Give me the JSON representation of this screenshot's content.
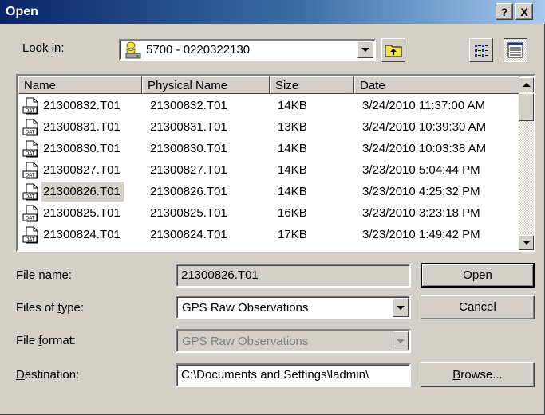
{
  "window": {
    "title": "Open",
    "help": "?",
    "close": "X"
  },
  "lookin": {
    "label_pre": "Look ",
    "label_key": "i",
    "label_post": "n:",
    "value": "5700 - 0220322130"
  },
  "columns": {
    "name": "Name",
    "physical": "Physical Name",
    "size": "Size",
    "date": "Date"
  },
  "files": [
    {
      "name": "21300832.T01",
      "physical": "21300832.T01",
      "size": "14KB",
      "date": "3/24/2010 11:37:00 AM"
    },
    {
      "name": "21300831.T01",
      "physical": "21300831.T01",
      "size": "13KB",
      "date": "3/24/2010 10:39:30 AM"
    },
    {
      "name": "21300830.T01",
      "physical": "21300830.T01",
      "size": "14KB",
      "date": "3/24/2010 10:03:38 AM"
    },
    {
      "name": "21300827.T01",
      "physical": "21300827.T01",
      "size": "14KB",
      "date": "3/23/2010 5:04:44 PM"
    },
    {
      "name": "21300826.T01",
      "physical": "21300826.T01",
      "size": "14KB",
      "date": "3/23/2010 4:25:32 PM"
    },
    {
      "name": "21300825.T01",
      "physical": "21300825.T01",
      "size": "16KB",
      "date": "3/23/2010 3:23:18 PM"
    },
    {
      "name": "21300824.T01",
      "physical": "21300824.T01",
      "size": "17KB",
      "date": "3/23/2010 1:49:42 PM"
    }
  ],
  "file_icon_text": "DAT",
  "filename": {
    "label_pre": "File ",
    "label_key": "n",
    "label_post": "ame:",
    "value": "21300826.T01"
  },
  "filetype": {
    "label_pre": "Files of ",
    "label_key": "t",
    "label_post": "ype:",
    "value": "GPS Raw Observations"
  },
  "fileformat": {
    "label_pre": "File ",
    "label_key": "f",
    "label_post": "ormat:",
    "value": "GPS Raw Observations"
  },
  "destination": {
    "label_key": "D",
    "label_post": "estination:",
    "value": "C:\\Documents and Settings\\ladmin\\"
  },
  "buttons": {
    "open_key": "O",
    "open_post": "pen",
    "cancel": "Cancel",
    "browse_key": "B",
    "browse_post": "rowse..."
  },
  "colors": {
    "title_start": "#0a246a",
    "title_end": "#a6caf0",
    "face": "#d4d0c8"
  }
}
